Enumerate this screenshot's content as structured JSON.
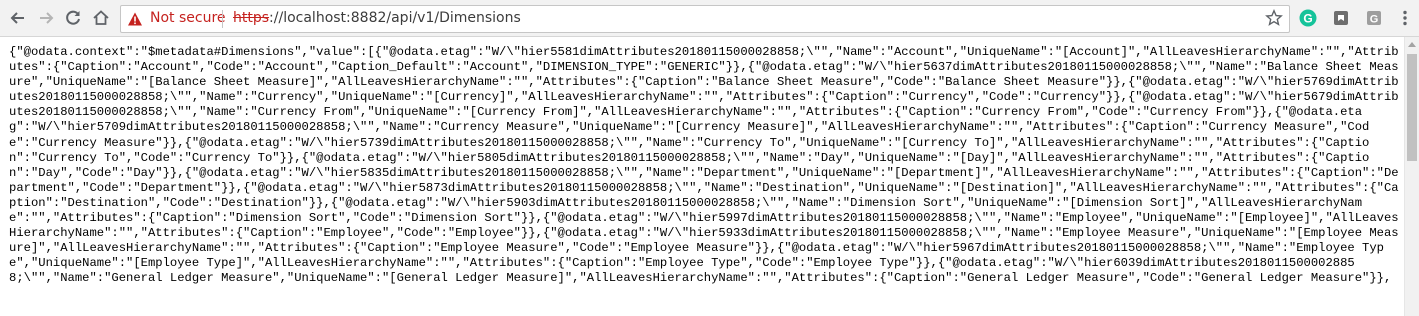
{
  "toolbar": {
    "back_icon": "back-arrow-icon",
    "forward_icon": "forward-arrow-icon",
    "reload_icon": "reload-icon",
    "home_icon": "home-icon",
    "security_label": "Not secure",
    "url_scheme": "https",
    "url_rest": "://localhost:8882/api/v1/Dimensions",
    "star_icon": "bookmark-star-icon",
    "extensions": [
      "grammarly-extension-icon",
      "extension-icon",
      "google-extension-icon"
    ],
    "menu_icon": "kebab-menu-icon"
  },
  "colors": {
    "warning": "#c5221f",
    "grammarly": "#15c39a",
    "extension": "#6e6e6e"
  },
  "content": {
    "json_text": "{\"@odata.context\":\"$metadata#Dimensions\",\"value\":[{\"@odata.etag\":\"W/\\\"hier5581dimAttributes20180115000028858;\\\"\",\"Name\":\"Account\",\"UniqueName\":\"[Account]\",\"AllLeavesHierarchyName\":\"\",\"Attributes\":{\"Caption\":\"Account\",\"Code\":\"Account\",\"Caption_Default\":\"Account\",\"DIMENSION_TYPE\":\"GENERIC\"}},{\"@odata.etag\":\"W/\\\"hier5637dimAttributes20180115000028858;\\\"\",\"Name\":\"Balance Sheet Measure\",\"UniqueName\":\"[Balance Sheet Measure]\",\"AllLeavesHierarchyName\":\"\",\"Attributes\":{\"Caption\":\"Balance Sheet Measure\",\"Code\":\"Balance Sheet Measure\"}},{\"@odata.etag\":\"W/\\\"hier5769dimAttributes20180115000028858;\\\"\",\"Name\":\"Currency\",\"UniqueName\":\"[Currency]\",\"AllLeavesHierarchyName\":\"\",\"Attributes\":{\"Caption\":\"Currency\",\"Code\":\"Currency\"}},{\"@odata.etag\":\"W/\\\"hier5679dimAttributes20180115000028858;\\\"\",\"Name\":\"Currency From\",\"UniqueName\":\"[Currency From]\",\"AllLeavesHierarchyName\":\"\",\"Attributes\":{\"Caption\":\"Currency From\",\"Code\":\"Currency From\"}},{\"@odata.etag\":\"W/\\\"hier5709dimAttributes20180115000028858;\\\"\",\"Name\":\"Currency Measure\",\"UniqueName\":\"[Currency Measure]\",\"AllLeavesHierarchyName\":\"\",\"Attributes\":{\"Caption\":\"Currency Measure\",\"Code\":\"Currency Measure\"}},{\"@odata.etag\":\"W/\\\"hier5739dimAttributes20180115000028858;\\\"\",\"Name\":\"Currency To\",\"UniqueName\":\"[Currency To]\",\"AllLeavesHierarchyName\":\"\",\"Attributes\":{\"Caption\":\"Currency To\",\"Code\":\"Currency To\"}},{\"@odata.etag\":\"W/\\\"hier5805dimAttributes20180115000028858;\\\"\",\"Name\":\"Day\",\"UniqueName\":\"[Day]\",\"AllLeavesHierarchyName\":\"\",\"Attributes\":{\"Caption\":\"Day\",\"Code\":\"Day\"}},{\"@odata.etag\":\"W/\\\"hier5835dimAttributes20180115000028858;\\\"\",\"Name\":\"Department\",\"UniqueName\":\"[Department]\",\"AllLeavesHierarchyName\":\"\",\"Attributes\":{\"Caption\":\"Department\",\"Code\":\"Department\"}},{\"@odata.etag\":\"W/\\\"hier5873dimAttributes20180115000028858;\\\"\",\"Name\":\"Destination\",\"UniqueName\":\"[Destination]\",\"AllLeavesHierarchyName\":\"\",\"Attributes\":{\"Caption\":\"Destination\",\"Code\":\"Destination\"}},{\"@odata.etag\":\"W/\\\"hier5903dimAttributes20180115000028858;\\\"\",\"Name\":\"Dimension Sort\",\"UniqueName\":\"[Dimension Sort]\",\"AllLeavesHierarchyName\":\"\",\"Attributes\":{\"Caption\":\"Dimension Sort\",\"Code\":\"Dimension Sort\"}},{\"@odata.etag\":\"W/\\\"hier5997dimAttributes20180115000028858;\\\"\",\"Name\":\"Employee\",\"UniqueName\":\"[Employee]\",\"AllLeavesHierarchyName\":\"\",\"Attributes\":{\"Caption\":\"Employee\",\"Code\":\"Employee\"}},{\"@odata.etag\":\"W/\\\"hier5933dimAttributes20180115000028858;\\\"\",\"Name\":\"Employee Measure\",\"UniqueName\":\"[Employee Measure]\",\"AllLeavesHierarchyName\":\"\",\"Attributes\":{\"Caption\":\"Employee Measure\",\"Code\":\"Employee Measure\"}},{\"@odata.etag\":\"W/\\\"hier5967dimAttributes20180115000028858;\\\"\",\"Name\":\"Employee Type\",\"UniqueName\":\"[Employee Type]\",\"AllLeavesHierarchyName\":\"\",\"Attributes\":{\"Caption\":\"Employee Type\",\"Code\":\"Employee Type\"}},{\"@odata.etag\":\"W/\\\"hier6039dimAttributes20180115000028858;\\\"\",\"Name\":\"General Ledger Measure\",\"UniqueName\":\"[General Ledger Measure]\",\"AllLeavesHierarchyName\":\"\",\"Attributes\":{\"Caption\":\"General Ledger Measure\",\"Code\":\"General Ledger Measure\"}},"
  }
}
